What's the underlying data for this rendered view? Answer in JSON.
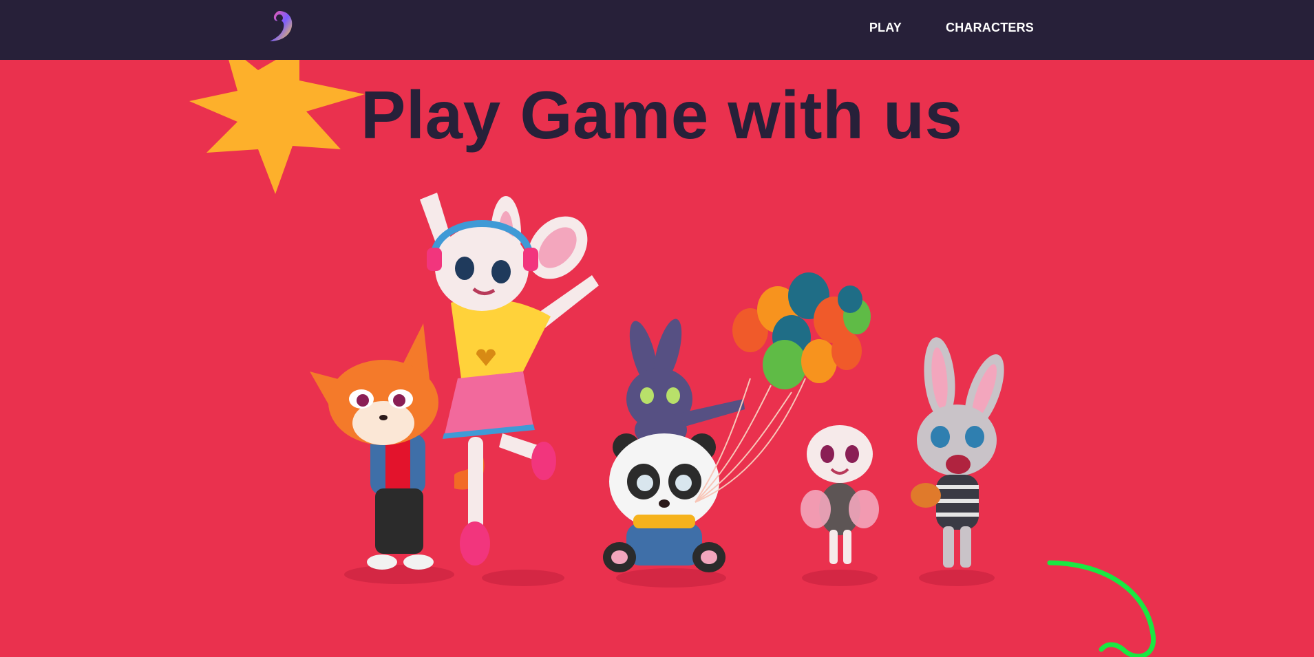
{
  "nav": {
    "logo_icon": "swirl-logo-icon",
    "links": [
      {
        "label": "PLAY"
      },
      {
        "label": "CHARACTERS"
      }
    ]
  },
  "hero": {
    "title": "Play Game with us",
    "illustration": "group-of-cartoon-characters",
    "decorations": [
      "sun-icon",
      "green-squiggle"
    ]
  },
  "colors": {
    "navbar_bg": "#272039",
    "hero_bg": "#ea314e",
    "headline": "#272039",
    "nav_text": "#ffffff",
    "sun": "#fdb02b",
    "squiggle": "#19e842"
  }
}
